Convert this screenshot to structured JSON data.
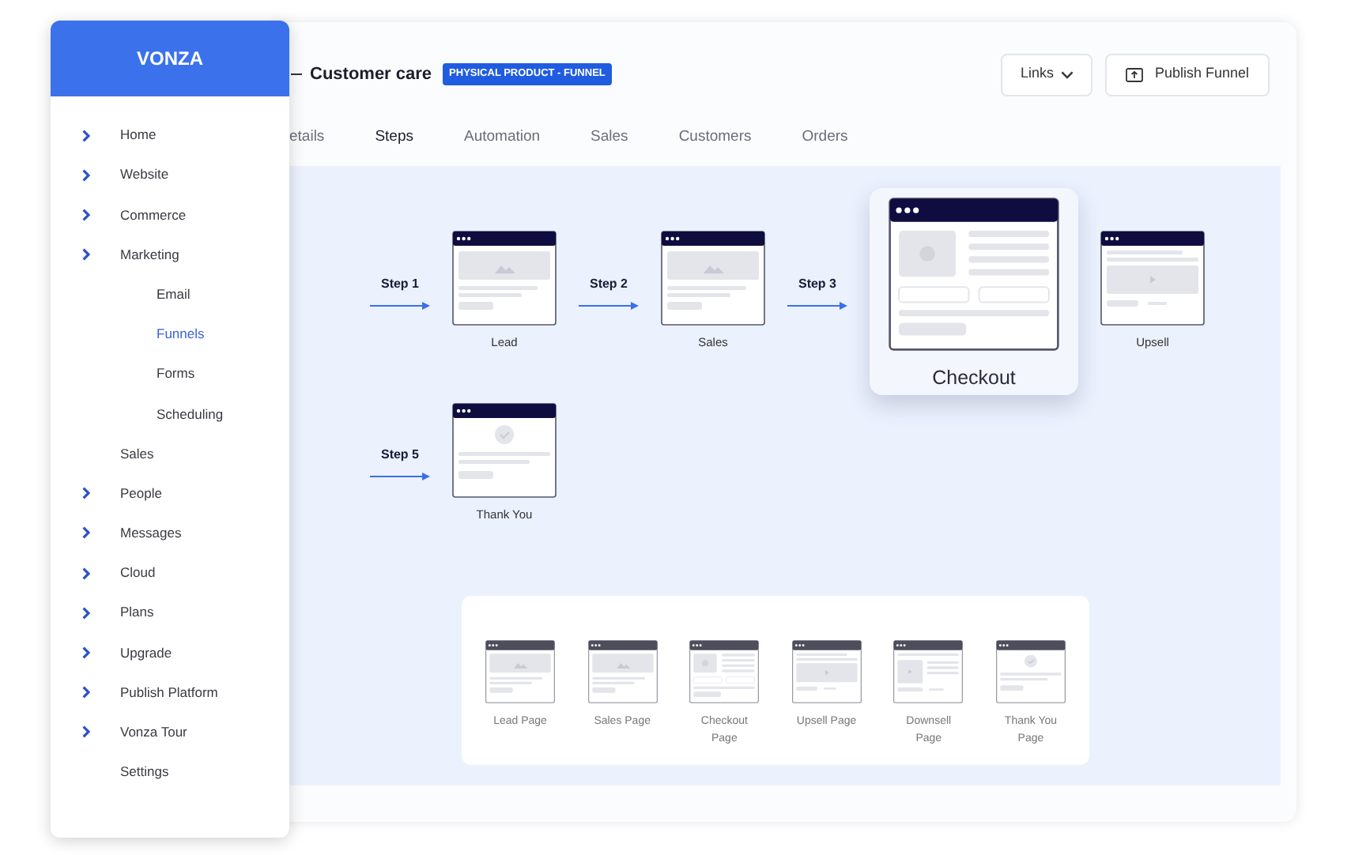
{
  "sidebar": {
    "brand": "VONZA",
    "items": [
      {
        "label": "Home",
        "has_submenu": true,
        "selected": false
      },
      {
        "label": "Website",
        "has_submenu": true,
        "selected": false
      },
      {
        "label": "Commerce",
        "has_submenu": true,
        "selected": false
      },
      {
        "label": "Marketing",
        "has_submenu": true,
        "selected": false,
        "children": [
          {
            "label": "Email",
            "selected": false
          },
          {
            "label": "Funnels",
            "selected": true
          },
          {
            "label": "Forms",
            "selected": false
          },
          {
            "label": "Scheduling",
            "selected": false
          }
        ]
      },
      {
        "label": "Sales",
        "has_submenu": false,
        "selected": false
      },
      {
        "label": "People",
        "has_submenu": true,
        "selected": false
      },
      {
        "label": "Messages",
        "has_submenu": true,
        "selected": false
      },
      {
        "label": "Cloud",
        "has_submenu": true,
        "selected": false
      },
      {
        "label": "Plans",
        "has_submenu": true,
        "selected": false
      },
      {
        "label": "Upgrade",
        "has_submenu": true,
        "selected": false
      },
      {
        "label": "Publish Platform",
        "has_submenu": true,
        "selected": false
      },
      {
        "label": "Vonza Tour",
        "has_submenu": true,
        "selected": false
      },
      {
        "label": "Settings",
        "has_submenu": false,
        "selected": false
      }
    ]
  },
  "header": {
    "title": "Customer care",
    "badge": "PHYSICAL PRODUCT - FUNNEL",
    "buttons": [
      {
        "label": "Links",
        "kind": "dropdown"
      },
      {
        "label": "Publish Funnel",
        "kind": "publish"
      }
    ]
  },
  "tabs": [
    {
      "label": "etails",
      "selected": false
    },
    {
      "label": "Steps",
      "selected": true
    },
    {
      "label": "Automation",
      "selected": false
    },
    {
      "label": "Sales",
      "selected": false
    },
    {
      "label": "Customers",
      "selected": false
    },
    {
      "label": "Orders",
      "selected": false
    }
  ],
  "funnel": {
    "rows": [
      [
        {
          "step": "Step 1",
          "name": "Lead",
          "kind": "lead",
          "highlighted": false
        },
        {
          "step": "Step 2",
          "name": "Sales",
          "kind": "sales",
          "highlighted": false
        },
        {
          "step": "Step 3",
          "name": "Checkout",
          "kind": "checkout",
          "highlighted": true
        },
        {
          "name": "Upsell",
          "kind": "upsell",
          "highlighted": false
        }
      ],
      [
        {
          "step": "Step 5",
          "name": "Thank You",
          "kind": "thankyou",
          "highlighted": false
        }
      ]
    ]
  },
  "templates": [
    {
      "name": "Lead Page",
      "kind": "lead"
    },
    {
      "name": "Sales Page",
      "kind": "sales"
    },
    {
      "name": "Checkout Page",
      "kind": "checkout"
    },
    {
      "name": "Upsell Page",
      "kind": "upsell"
    },
    {
      "name": "Downsell Page",
      "kind": "downsell"
    },
    {
      "name": "Thank You Page",
      "kind": "thankyou"
    }
  ]
}
